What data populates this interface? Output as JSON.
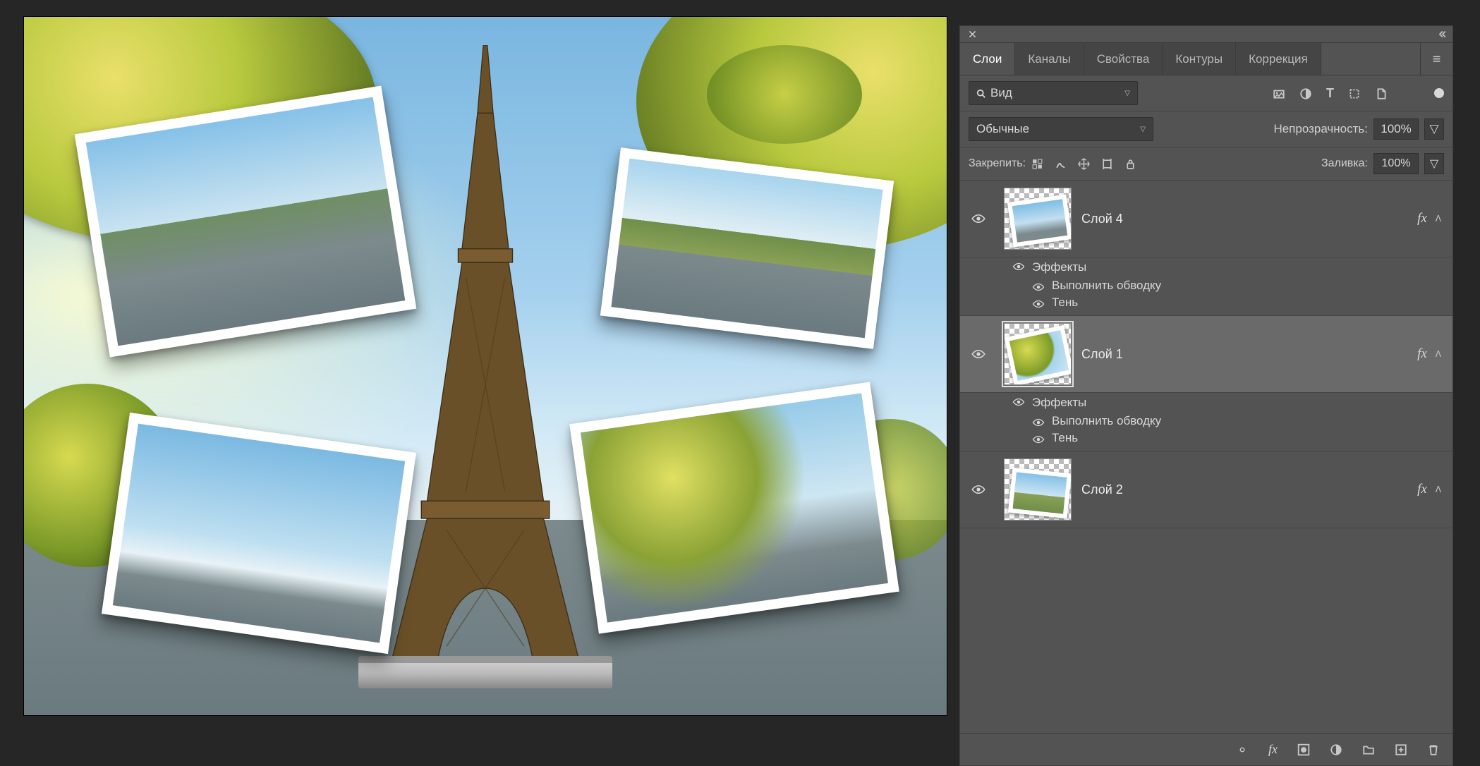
{
  "tabs": {
    "layers": "Слои",
    "channels": "Каналы",
    "properties": "Свойства",
    "paths": "Контуры",
    "adjustments": "Коррекция"
  },
  "filter": {
    "search_label": "Вид"
  },
  "blend": {
    "mode": "Обычные",
    "opacity_label": "Непрозрачность:",
    "opacity_value": "100%"
  },
  "lock": {
    "label": "Закрепить:",
    "fill_label": "Заливка:",
    "fill_value": "100%"
  },
  "layers": {
    "l0": {
      "name": "Слой 4"
    },
    "l1": {
      "name": "Слой 1"
    },
    "l2": {
      "name": "Слой 2"
    }
  },
  "effects": {
    "group_title": "Эффекты",
    "stroke": "Выполнить обводку",
    "shadow": "Тень"
  },
  "fx_label": "fx"
}
